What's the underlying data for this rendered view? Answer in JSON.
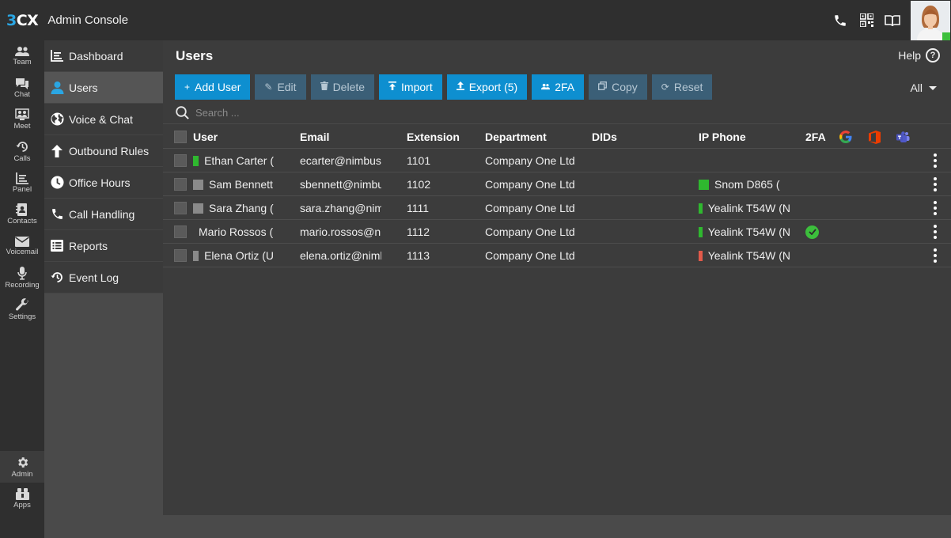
{
  "app": {
    "logo_a": "3",
    "logo_b": "CX",
    "title": "Admin Console"
  },
  "colors": {
    "accent": "#0e8fd0",
    "online": "#2fb82f",
    "offline": "#e25a4a",
    "neutral": "#8a8a8a"
  },
  "rail": {
    "team": "Team",
    "chat": "Chat",
    "meet": "Meet",
    "calls": "Calls",
    "panel": "Panel",
    "contacts": "Contacts",
    "voicemail": "Voicemail",
    "recording": "Recording",
    "settings": "Settings",
    "admin": "Admin",
    "apps": "Apps"
  },
  "nav": {
    "dashboard": "Dashboard",
    "users": "Users",
    "voice_chat": "Voice & Chat",
    "outbound_rules": "Outbound Rules",
    "office_hours": "Office Hours",
    "call_handling": "Call Handling",
    "reports": "Reports",
    "event_log": "Event Log"
  },
  "page": {
    "title": "Users",
    "help": "Help",
    "help_glyph": "?"
  },
  "toolbar": {
    "add_user": "Add User",
    "edit": "Edit",
    "delete": "Delete",
    "import": "Import",
    "export": "Export (5)",
    "twofa": "2FA",
    "copy": "Copy",
    "reset": "Reset",
    "filter": "All"
  },
  "search": {
    "placeholder": "Search ..."
  },
  "table": {
    "headers": {
      "user": "User",
      "email": "Email",
      "extension": "Extension",
      "department": "Department",
      "dids": "DIDs",
      "ip_phone": "IP Phone",
      "twofa": "2FA"
    },
    "rows": [
      {
        "user": "Ethan Carter (",
        "status": "online",
        "email": "ecarter@nimbusl",
        "extension": "1101",
        "department": "Company One Ltd",
        "ip_phone": "",
        "phone_status": "",
        "twofa": false
      },
      {
        "user": "Sam Bennett",
        "status": "neutral",
        "email": "sbennett@nimbu",
        "extension": "1102",
        "department": "Company One Ltd",
        "ip_phone": "Snom D865 (",
        "phone_status": "online",
        "twofa": false
      },
      {
        "user": "Sara Zhang (",
        "status": "neutral",
        "email": "sara.zhang@nim",
        "extension": "1111",
        "department": "Company One Ltd",
        "ip_phone": "Yealink T54W (N",
        "phone_status": "online",
        "twofa": false
      },
      {
        "user": "Mario Rossos (U",
        "status": "neutral",
        "email": "mario.rossos@ni",
        "extension": "1112",
        "department": "Company One Ltd",
        "ip_phone": "Yealink T54W (N",
        "phone_status": "online",
        "twofa": true
      },
      {
        "user": "Elena Ortiz (U",
        "status": "neutral",
        "email": "elena.ortiz@nimb",
        "extension": "1113",
        "department": "Company One Ltd",
        "ip_phone": "Yealink T54W (N",
        "phone_status": "offline",
        "twofa": false
      }
    ]
  }
}
